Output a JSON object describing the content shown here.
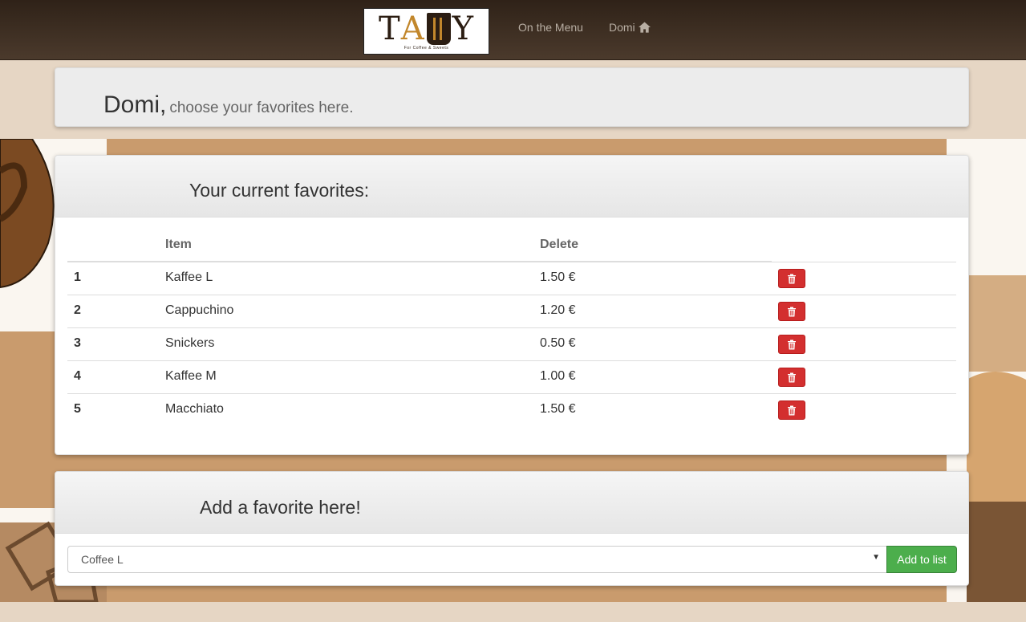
{
  "navbar": {
    "logo_text": "TALLY",
    "logo_sub": "For Coffee & Sweets",
    "menu_link": "On the Menu",
    "user_link": "Domi",
    "user_icon": "home-icon"
  },
  "header": {
    "name": "Domi,",
    "subtitle": "choose your favorites here."
  },
  "favorites": {
    "title": "Your current favorites:",
    "columns": [
      "",
      "Item",
      "Delete"
    ],
    "rows": [
      {
        "num": "1",
        "item": "Kaffee L",
        "price": "1.50 €"
      },
      {
        "num": "2",
        "item": "Cappuchino",
        "price": "1.20 €"
      },
      {
        "num": "3",
        "item": "Snickers",
        "price": "0.50 €"
      },
      {
        "num": "4",
        "item": "Kaffee M",
        "price": "1.00 €"
      },
      {
        "num": "5",
        "item": "Macchiato",
        "price": "1.50 €"
      }
    ],
    "delete_icon": "trash-icon"
  },
  "add": {
    "title": "Add a favorite here!",
    "selected": "Coffee L",
    "button": "Add to list"
  },
  "colors": {
    "navbar": "#3a2b1f",
    "delete": "#d32f2f",
    "add": "#4cae4c"
  }
}
